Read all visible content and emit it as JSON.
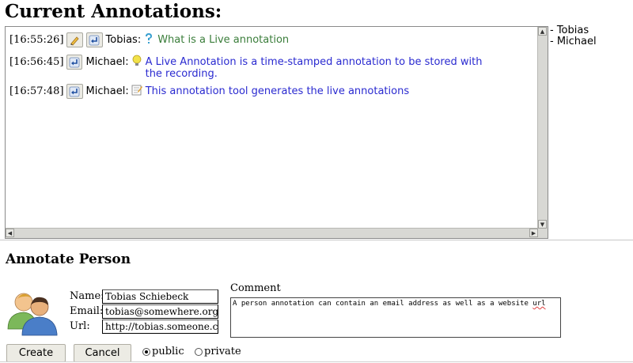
{
  "heading": "Current Annotations:",
  "annotations": [
    {
      "time": "[16:55:26]",
      "user": "Tobias:",
      "text": "What is a Live annotation",
      "type": "question-icon",
      "color": "#3a7d3a",
      "buttons": [
        "edit-icon",
        "reply-icon"
      ]
    },
    {
      "time": "[16:56:45]",
      "user": "Michael:",
      "text": "A Live Annotation is a time-stamped annotation to be stored with the recording.",
      "type": "lightbulb-icon",
      "color": "#2a2ad0",
      "buttons": [
        "reply-icon"
      ]
    },
    {
      "time": "[16:57:48]",
      "user": "Michael:",
      "text": "This annotation tool generates the live annotations",
      "type": "note-icon",
      "color": "#2a2ad0",
      "buttons": [
        "reply-icon"
      ]
    }
  ],
  "participants": [
    "- Tobias",
    "- Michael"
  ],
  "person_form": {
    "heading": "Annotate Person",
    "name_label": "Name:",
    "name_value": "Tobias Schiebeck",
    "email_label": "Email:",
    "email_value": "tobias@somewhere.org",
    "url_label": "Url:",
    "url_value": "http://tobias.someone.com",
    "comment_label": "Comment",
    "comment_text": "A person annotation can contain an email address as well as a website",
    "comment_misspelled": "url",
    "create_label": "Create",
    "cancel_label": "Cancel",
    "visibility_options": [
      "public",
      "private"
    ],
    "visibility_selected": "public"
  }
}
